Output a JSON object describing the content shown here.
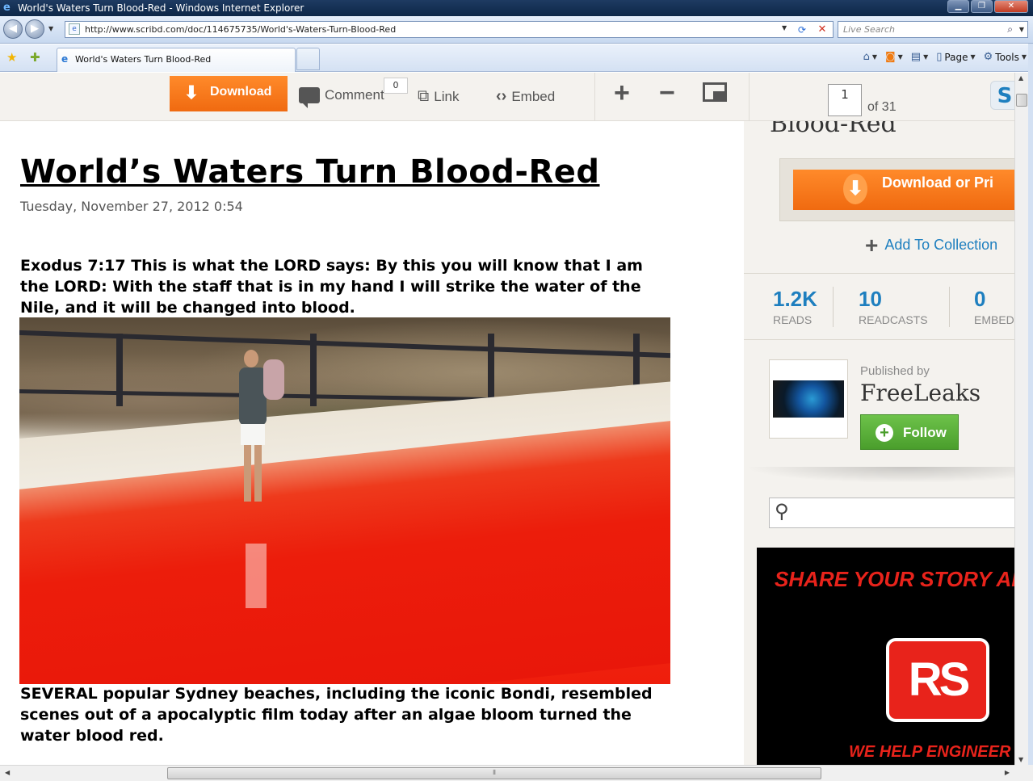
{
  "window": {
    "title": "World's Waters Turn Blood-Red - Windows Internet Explorer",
    "url": "http://www.scribd.com/doc/114675735/World's-Waters-Turn-Blood-Red",
    "search_placeholder": "Live Search",
    "tab_title": "World's Waters Turn Blood-Red",
    "commands": [
      "Page",
      "Tools"
    ]
  },
  "toolbar": {
    "download_label": "Download",
    "comment_label": "Comment",
    "comment_count": "0",
    "link_label": "Link",
    "embed_label": "Embed",
    "zoom_in": "+",
    "zoom_out": "−",
    "page_current": "1",
    "page_total_label": "of 31"
  },
  "document": {
    "title": "World’s Waters Turn Blood-Red",
    "date": "Tuesday, November 27, 2012 0:54",
    "paragraph1": "Exodus 7:17 This is what the LORD says: By this you will know that I am the LORD: With the staff that is in my hand I will strike the water of the Nile, and it will be changed into blood.",
    "paragraph2": "SEVERAL popular Sydney beaches, including the iconic Bondi, resembled scenes out of a apocalyptic film today after an algae bloom turned the water blood red."
  },
  "sidebar": {
    "cut_title": "Blood-Red",
    "download_print_label": "Download or Pri",
    "add_collection_label": "Add To Collection",
    "stats": [
      {
        "value": "1.2K",
        "label": "READS"
      },
      {
        "value": "10",
        "label": "READCASTS"
      },
      {
        "value": "0",
        "label": "EMBED"
      }
    ],
    "published_by_label": "Published by",
    "publisher": "FreeLeaks",
    "follow_label": "Follow",
    "ad": {
      "top_text": "SHARE YOUR STORY AI",
      "logo_text": "RS",
      "bottom_text": "WE HELP ENGINEER"
    }
  },
  "colors": {
    "accent_orange": "#f06a10",
    "link_blue": "#1e7fbf",
    "follow_green": "#4a9e2c",
    "ad_red": "#e8231b"
  }
}
